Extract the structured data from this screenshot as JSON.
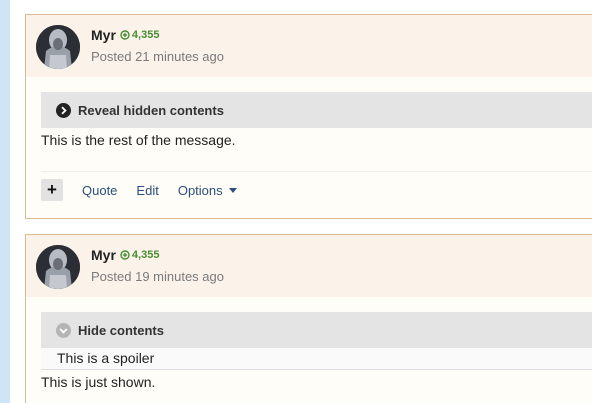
{
  "posts": [
    {
      "author": "Myr",
      "reputation": "4,355",
      "posted": "Posted 21 minutes ago",
      "spoiler": {
        "label": "Reveal hidden contents",
        "state": "collapsed"
      },
      "body": "This is the rest of the message.",
      "actions": {
        "plus": "+",
        "quote": "Quote",
        "edit": "Edit",
        "options": "Options"
      }
    },
    {
      "author": "Myr",
      "reputation": "4,355",
      "posted": "Posted 19 minutes ago",
      "spoiler": {
        "label": "Hide contents",
        "state": "expanded",
        "content": "This is a spoiler"
      },
      "body": "This is just shown."
    }
  ],
  "colors": {
    "accent_link": "#2b4f7c",
    "reputation": "#4a8c33",
    "post_border": "#d8b993",
    "header_bg": "#fbf3ea",
    "left_rail": "#cfe4f5"
  },
  "icons": {
    "reputation": "plus-circle-icon",
    "spoiler_collapsed": "chevron-right-circle-icon",
    "spoiler_expanded": "chevron-down-circle-icon",
    "options_caret": "caret-down-icon"
  }
}
